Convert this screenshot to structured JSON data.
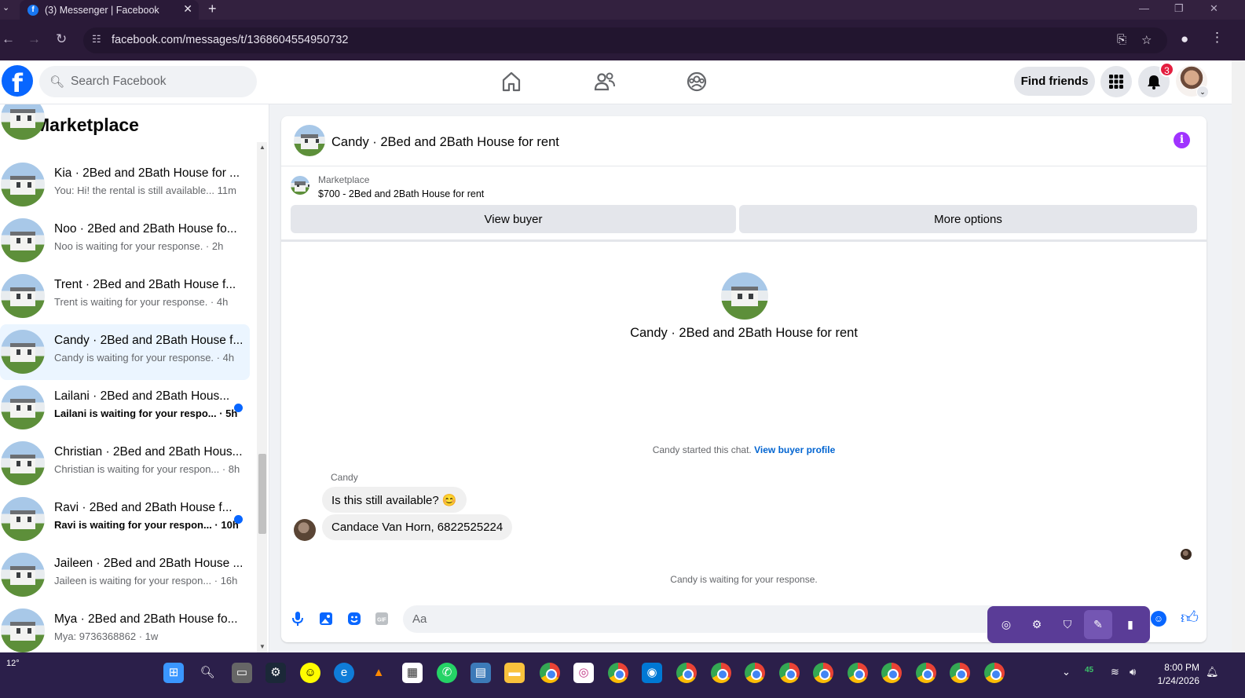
{
  "browser": {
    "tab_title": "(3) Messenger | Facebook",
    "tab_favicon": "f",
    "url": "facebook.com/messages/t/1368604554950732"
  },
  "header": {
    "logo": "f",
    "search_placeholder": "Search Facebook",
    "find_friends": "Find friends",
    "notification_count": "3"
  },
  "sidebar": {
    "title": "Marketplace",
    "conversations": [
      {
        "name": "Kia · 2Bed and 2Bath House for ...",
        "preview": "You: Hi! the rental is still available... 11m",
        "unread": false,
        "active": false
      },
      {
        "name": "Noo · 2Bed and 2Bath House fo...",
        "preview": "Noo is waiting for your response. · 2h",
        "unread": false,
        "active": false
      },
      {
        "name": "Trent · 2Bed and 2Bath House f...",
        "preview": "Trent is waiting for your response. · 4h",
        "unread": false,
        "active": false
      },
      {
        "name": "Candy · 2Bed and 2Bath House f...",
        "preview": "Candy is waiting for your response. · 4h",
        "unread": false,
        "active": true
      },
      {
        "name": "Lailani · 2Bed and 2Bath Hous...",
        "preview": "Lailani is waiting for your respo... · 5h",
        "unread": true,
        "active": false
      },
      {
        "name": "Christian · 2Bed and 2Bath Hous...",
        "preview": "Christian is waiting for your respon... · 8h",
        "unread": false,
        "active": false
      },
      {
        "name": "Ravi · 2Bed and 2Bath House f...",
        "preview": "Ravi is waiting for your respon... · 10h",
        "unread": true,
        "active": false
      },
      {
        "name": "Jaileen · 2Bed and 2Bath House ...",
        "preview": "Jaileen is waiting for your respon... · 16h",
        "unread": false,
        "active": false
      },
      {
        "name": "Mya · 2Bed and 2Bath House fo...",
        "preview": "Mya: 9736368862 · 1w",
        "unread": false,
        "active": false
      }
    ]
  },
  "chat": {
    "title": "Candy · 2Bed and 2Bath House for rent",
    "listing_label": "Marketplace",
    "listing_price": "$700 - 2Bed and 2Bath House for rent",
    "view_buyer": "View buyer",
    "more_options": "More options",
    "intro_title": "Candy · 2Bed and 2Bath House for rent",
    "started_text": "Candy started this chat.",
    "view_buyer_profile": "View buyer profile",
    "sender": "Candy",
    "messages": [
      "Is this still available? 😊",
      "Candace Van Horn, 6822525224"
    ],
    "waiting": "Candy is waiting for your response.",
    "composer_placeholder": "Aa"
  },
  "taskbar": {
    "weather": "12°",
    "battery": "45",
    "time": "8:00 PM",
    "date": "1/24/2026"
  }
}
